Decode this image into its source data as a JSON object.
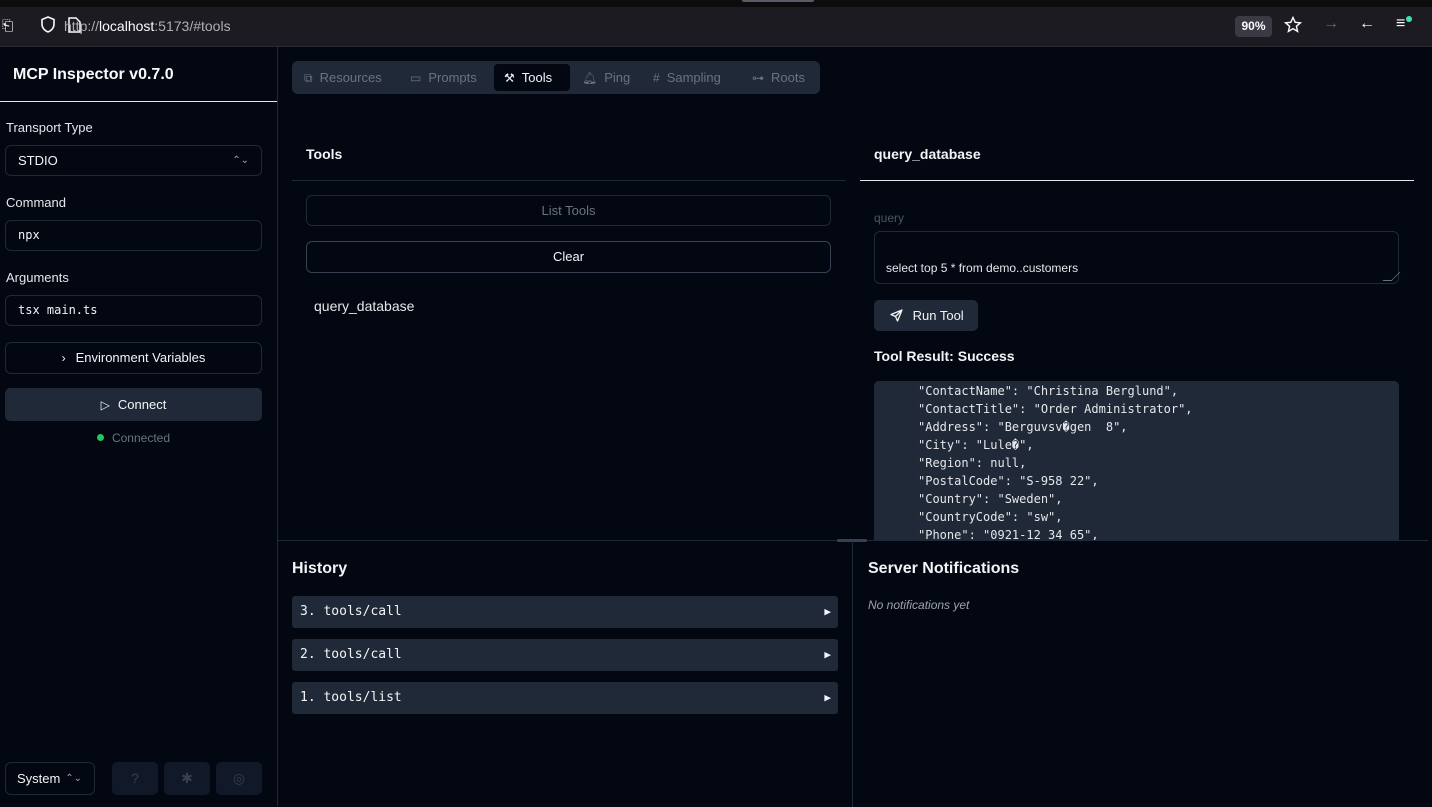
{
  "browser": {
    "url_prefix": "http://",
    "url_host": "localhost",
    "url_rest": ":5173/#tools",
    "zoom": "90%"
  },
  "sidebar": {
    "title": "MCP Inspector v0.7.0",
    "transport_label": "Transport Type",
    "transport_value": "STDIO",
    "command_label": "Command",
    "command_value": "npx",
    "arguments_label": "Arguments",
    "arguments_value": "tsx main.ts",
    "env_button": "Environment Variables",
    "connect_button": "Connect",
    "status_text": "Connected",
    "theme_select": "System"
  },
  "tabs": [
    {
      "label": "Resources",
      "icon": "resources-icon"
    },
    {
      "label": "Prompts",
      "icon": "prompts-icon"
    },
    {
      "label": "Tools",
      "icon": "tools-icon",
      "active": true
    },
    {
      "label": "Ping",
      "icon": "bell-icon"
    },
    {
      "label": "Sampling",
      "icon": "hash-icon"
    },
    {
      "label": "Roots",
      "icon": "roots-icon"
    }
  ],
  "tools_panel": {
    "title": "Tools",
    "list_button": "List Tools",
    "clear_button": "Clear",
    "items": [
      "query_database"
    ]
  },
  "tool_detail": {
    "title": "query_database",
    "query_label": "query",
    "query_value": "select top 5 * from demo..customers",
    "run_button": "Run Tool",
    "result_title": "Tool Result: Success",
    "result_lines": [
      "\"ContactName\": \"Christina Berglund\",",
      "\"ContactTitle\": \"Order Administrator\",",
      "\"Address\": \"Berguvsv�gen  8\",",
      "\"City\": \"Lule�\",",
      "\"Region\": null,",
      "\"PostalCode\": \"S-958 22\",",
      "\"Country\": \"Sweden\",",
      "\"CountryCode\": \"sw\",",
      "\"Phone\": \"0921-12 34 65\","
    ]
  },
  "history": {
    "title": "History",
    "items": [
      "3. tools/call",
      "2. tools/call",
      "1. tools/list"
    ]
  },
  "notifications": {
    "title": "Server Notifications",
    "empty_text": "No notifications yet"
  }
}
